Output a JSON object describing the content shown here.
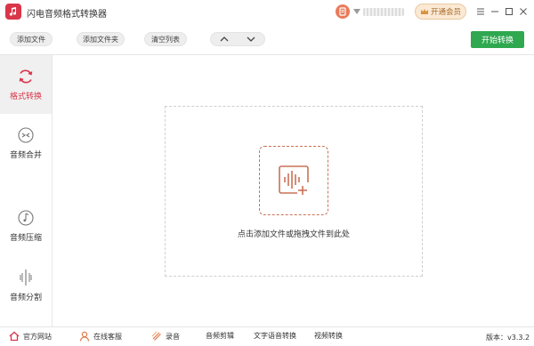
{
  "window": {
    "title": "闪电音频格式转换器",
    "vip_label": "开通会员"
  },
  "toolbar": {
    "add_file": "添加文件",
    "add_folder": "添加文件夹",
    "clear_list": "清空列表",
    "start_convert": "开始转换"
  },
  "sidebar": {
    "items": [
      {
        "label": "格式转换",
        "icon": "refresh-icon",
        "active": true
      },
      {
        "label": "音频合并",
        "icon": "merge-icon",
        "active": false
      },
      {
        "label": "音频压缩",
        "icon": "music-note-icon",
        "active": false
      },
      {
        "label": "音频分割",
        "icon": "split-icon",
        "active": false
      }
    ]
  },
  "main": {
    "drop_hint": "点击添加文件或拖拽文件到此处"
  },
  "bottom": {
    "website": "官方网站",
    "support": "在线客服",
    "record": "录音",
    "audio_cut": "音频剪辑",
    "text_to_speech": "文字语音转换",
    "video_convert": "视频转换",
    "version": "版本：v3.3.2"
  },
  "colors": {
    "accent_red": "#d9364a",
    "start_green": "#2fa84f",
    "dashed_orange": "#c97256",
    "vip_gold": "#a56a2c"
  }
}
